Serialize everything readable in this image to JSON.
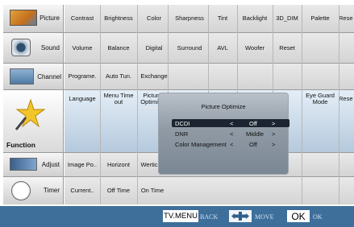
{
  "menu": [
    {
      "label": "Picture",
      "icon": "picture-icon",
      "items": [
        "Contrast",
        "Brightness",
        "Color",
        "Sharpness",
        "Tint",
        "Backlight",
        "3D_DIM",
        "Palette",
        "Rese"
      ]
    },
    {
      "label": "Sound",
      "icon": "speaker-icon",
      "items": [
        "Volume",
        "Balance",
        "Digital",
        "Surround",
        "AVL",
        "Woofer",
        "Reset"
      ]
    },
    {
      "label": "Channel",
      "icon": "channel-icon",
      "items": [
        "Programe.",
        "Auto Tun.",
        "Exchange"
      ]
    },
    {
      "label": "Function",
      "icon": "magic-wand-icon",
      "items": [
        "Language",
        "Menu Time out",
        "Picture Optimize",
        "Eye Guard Mode",
        "Rese"
      ]
    },
    {
      "label": "Adjust",
      "icon": "adjust-icon",
      "items": [
        "Image Po..",
        "Horizont",
        "Wertical."
      ]
    },
    {
      "label": "Timer",
      "icon": "clock-icon",
      "items": [
        "Current..",
        "Off Time",
        "On Time"
      ]
    }
  ],
  "popup": {
    "title": "Picture Optimize",
    "rows": [
      {
        "name": "DCDI",
        "left": "<",
        "value": "Off",
        "right": ">"
      },
      {
        "name": "DNR",
        "left": "<",
        "value": "Middle",
        "right": ">"
      },
      {
        "name": "Color Management",
        "left": "<",
        "value": "Off",
        "right": ">"
      }
    ]
  },
  "bottom": {
    "tv_menu": "TV.MENU",
    "back": "BACK",
    "move": "MOVE",
    "ok_button": "OK",
    "ok_text": "OK"
  }
}
